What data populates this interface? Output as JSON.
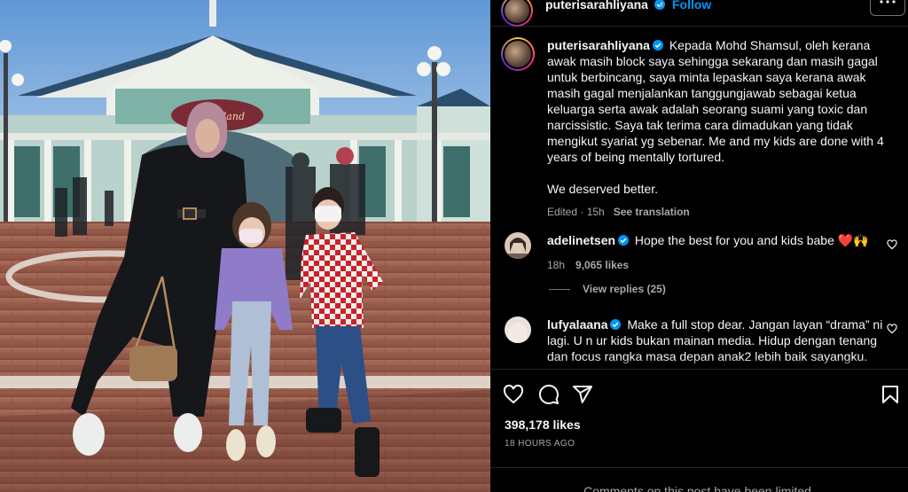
{
  "post": {
    "username": "puterisarahliyana",
    "dot": "•",
    "follow_label": "Follow",
    "more_icon": "more-icon"
  },
  "caption": {
    "username": "puterisarahliyana",
    "paragraph1": "Kepada Mohd Shamsul, oleh kerana awak masih block saya sehingga sekarang dan masih gagal untuk berbincang, saya minta lepaskan saya kerana awak masih gagal menjalankan tanggungjawab sebagai ketua keluarga serta awak adalah seorang suami yang toxic dan narcissistic. Saya tak terima cara dimadukan yang tidak mengikut syariat yg sebenar. Me and my kids are done with 4 years of being mentally tortured.",
    "paragraph2": "We deserved better.",
    "edited": "Edited · 15h",
    "see_translation": "See translation"
  },
  "comments": [
    {
      "username": "adelinetsen",
      "text": "Hope the best for you and kids babe ❤️🙌",
      "age": "18h",
      "likes": "9,065 likes",
      "view_replies": "View replies (25)"
    },
    {
      "username": "lufyalaana",
      "text": "Make a full stop dear. Jangan layan “drama” ni lagi. U n ur kids bukan mainan media. Hidup dengan tenang dan focus rangka masa depan anak2 lebih baik sayangku."
    }
  ],
  "actions": {
    "likes": "398,178 likes",
    "time_ago": "18 HOURS AGO"
  },
  "footer": {
    "limited": "Comments on this post have been limited."
  },
  "photo": {
    "sign_text": "Disneyland"
  },
  "colors": {
    "accent": "#0095f6",
    "verified": "#0095f6",
    "muted": "#a8a8a8"
  }
}
